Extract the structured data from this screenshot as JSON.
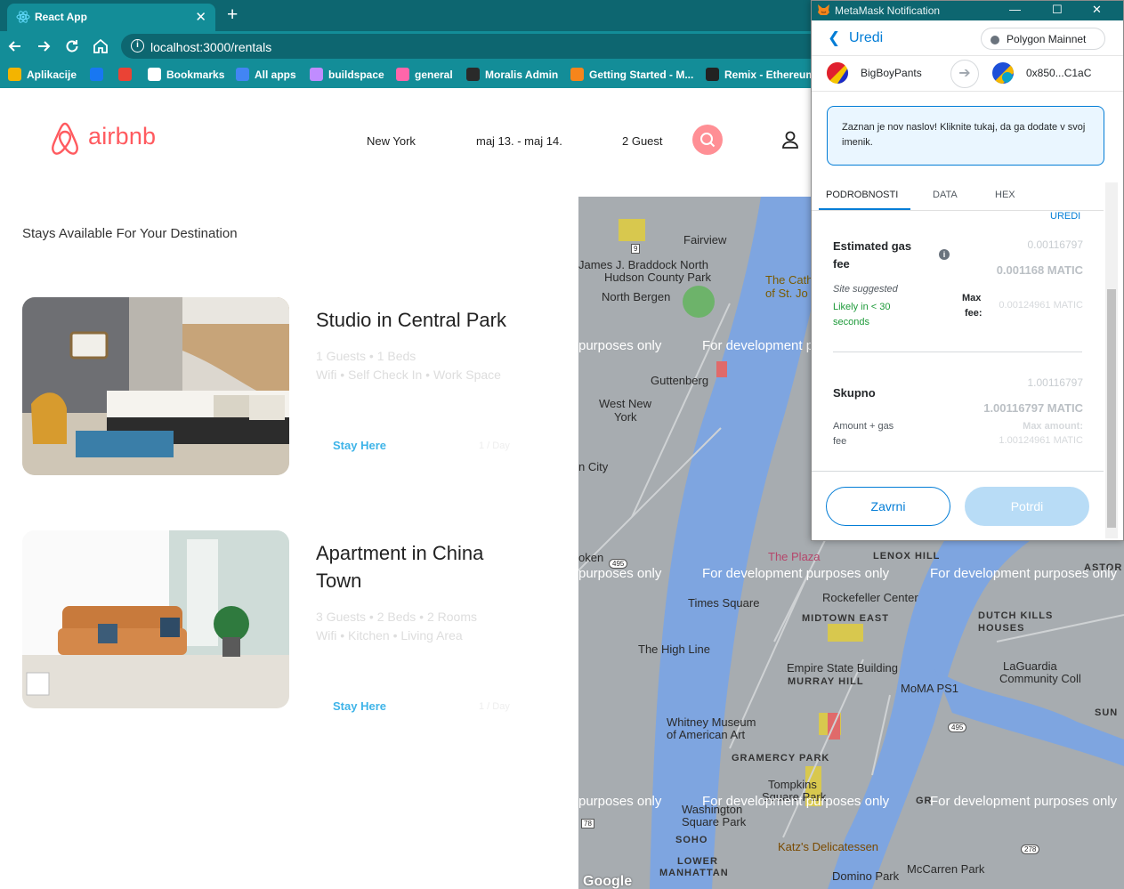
{
  "browser": {
    "tab_title": "React App",
    "url": "localhost:3000/rentals",
    "bookmarks": [
      {
        "label": "Aplikacije",
        "icon": "apps-grid-icon",
        "color": "#f4b400"
      },
      {
        "label": "",
        "icon": "facebook-icon",
        "color": "#1877f2"
      },
      {
        "label": "",
        "icon": "gmail-icon",
        "color": "#ea4335"
      },
      {
        "label": "Bookmarks",
        "icon": "star-icon",
        "color": "#ffffff"
      },
      {
        "label": "All apps",
        "icon": "apps-icon",
        "color": "#4285f4"
      },
      {
        "label": "buildspace",
        "icon": "unicorn-icon",
        "color": "#c08cff"
      },
      {
        "label": "general",
        "icon": "discord-icon",
        "color": "#ff66aa"
      },
      {
        "label": "Moralis Admin",
        "icon": "moralis-icon",
        "color": "#2a2a2a"
      },
      {
        "label": "Getting Started - M...",
        "icon": "fox-icon",
        "color": "#f6851b"
      },
      {
        "label": "Remix - Ethereum...",
        "icon": "remix-icon",
        "color": "#222222"
      }
    ]
  },
  "header": {
    "logo_text": "airbnb",
    "location": "New York",
    "dates": "maj 13. - maj 14.",
    "guests": "2 Guest",
    "accent": "#ff5a5f"
  },
  "main": {
    "section_title": "Stays Available For Your Destination",
    "rentals": [
      {
        "title": "Studio in Central Park",
        "desc1": "1 Guests • 1 Beds",
        "desc2": "Wifi • Self Check In • Work Space",
        "button": "Stay Here",
        "price": "1 / Day"
      },
      {
        "title": "Apartment in China Town",
        "desc1": "3 Guests • 2 Beds • 2 Rooms",
        "desc2": "Wifi • Kitchen • Living Area",
        "button": "Stay Here",
        "price": "1 / Day"
      }
    ]
  },
  "map": {
    "dev_watermark": "For development purposes only",
    "dev_watermark_short": "purposes only",
    "labels": {
      "fairview": "Fairview",
      "braddock": "James J. Braddock North",
      "hudson_park": "Hudson County Park",
      "north_bergen": "North Bergen",
      "guttenberg": "Guttenberg",
      "west_new_york": "West New",
      "west_new_york2": "York",
      "union_city": "n City",
      "cath": "The Cath",
      "cath2": "of St. Jo",
      "plaza": "The Plaza",
      "rockefeller": "Rockefeller Center",
      "times_square": "Times Square",
      "high_line": "The High Line",
      "empire": "Empire State Building",
      "moma": "MoMA PS1",
      "laguardia": "LaGuardia",
      "laguardia2": "Community Coll",
      "whitney": "Whitney Museum",
      "whitney2": "of American Art",
      "tompkins": "Tompkins",
      "tompkins2": "Square Park",
      "washington": "Washington",
      "washington2": "Square Park",
      "katz": "Katz's Delicatessen",
      "mccarren": "McCarren Park",
      "domino": "Domino Park",
      "hoboken": "oken"
    },
    "districts": {
      "lenox": "LENOX HILL",
      "midtown": "MIDTOWN EAST",
      "dutch1": "DUTCH KILLS",
      "dutch2": "HOUSES",
      "murray": "MURRAY HILL",
      "gramercy": "GRAMERCY PARK",
      "soho": "SOHO",
      "lower1": "LOWER",
      "lower2": "MANHATTAN",
      "astoria": "ASTOR",
      "sun": "SUN",
      "gr": "GR"
    },
    "roads": {
      "i495": "495",
      "i278": "278",
      "r78": "78",
      "r9": "9"
    },
    "google": "Google"
  },
  "metamask": {
    "window_title": "MetaMask Notification",
    "back_label": "Uredi",
    "network": "Polygon Mainnet",
    "from_account": "BigBoyPants",
    "to_account": "0x850...C1aC",
    "notice": "Zaznan je nov naslov! Kliknite tukaj, da ga dodate v svoj imenik.",
    "tabs": [
      "PODROBNOSTI",
      "DATA",
      "HEX"
    ],
    "edit_link": "UREDI",
    "gas_label": "Estimated gas",
    "gas_label2": "fee",
    "gas_value_small": "0.00116797",
    "gas_value": "0.001168 MATIC",
    "site_suggested": "Site suggested",
    "likely": "Likely in < 30",
    "likely2": "seconds",
    "max_fee_label": "Max",
    "max_fee_label2": "fee:",
    "max_fee_value": "0.00124961 MATIC",
    "total_label": "Skupno",
    "total_small": "1.00116797",
    "total_value": "1.00116797 MATIC",
    "amount_gas": "Amount + gas",
    "amount_gas2": "fee",
    "max_amount_label": "Max amount:",
    "max_amount_value": "1.00124961 MATIC",
    "reject": "Zavrni",
    "confirm": "Potrdi"
  }
}
